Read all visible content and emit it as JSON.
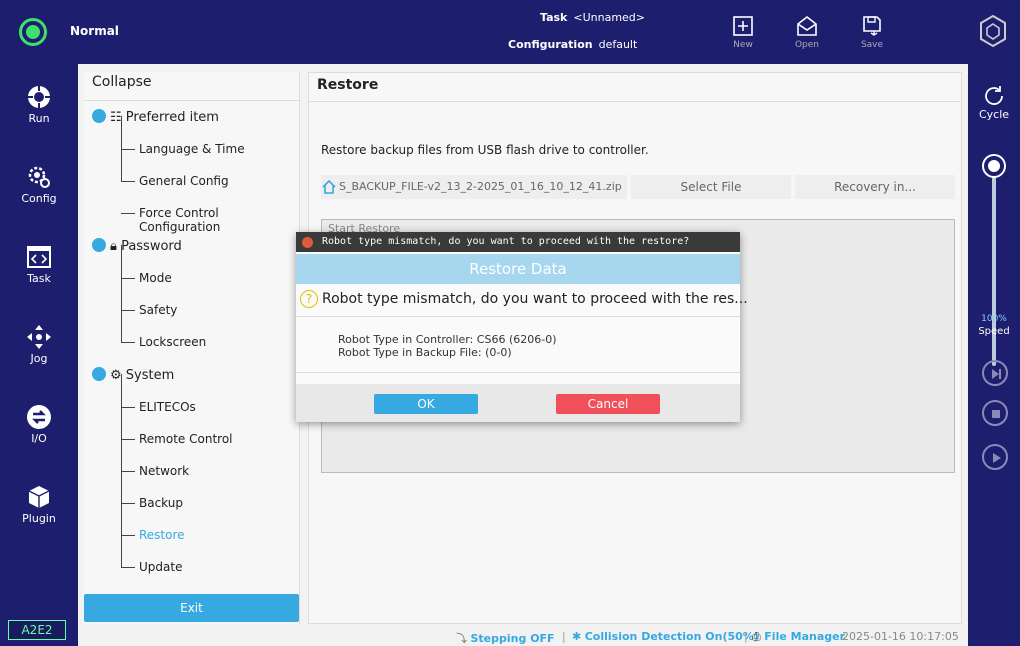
{
  "header": {
    "status": "Normal",
    "task_label": "Task",
    "task_value": "<Unnamed>",
    "config_label": "Configuration",
    "config_value": "default",
    "new_label": "New",
    "open_label": "Open",
    "save_label": "Save"
  },
  "leftnav": {
    "run": "Run",
    "config": "Config",
    "task": "Task",
    "jog": "Jog",
    "io": "I/O",
    "plugin": "Plugin",
    "badge": "A2E2"
  },
  "rightnav": {
    "cycle": "Cycle",
    "speed_value": "100%",
    "speed_label": "Speed",
    "speed_fraction": 1.0
  },
  "tree": {
    "collapse": "Collapse",
    "groups": {
      "preferred": "Preferred item",
      "password": "Password",
      "system": "System"
    },
    "items": {
      "language": "Language & Time",
      "general": "General Config",
      "force": "Force Control Configuration",
      "mode": "Mode",
      "safety": "Safety",
      "lockscreen": "Lockscreen",
      "elitecos": "ELITECOs",
      "remote": "Remote Control",
      "network": "Network",
      "backup": "Backup",
      "restore": "Restore",
      "update": "Update"
    },
    "exit": "Exit"
  },
  "content": {
    "title": "Restore",
    "description": "Restore backup files from USB flash drive to controller.",
    "file_name": "S_BACKUP_FILE-v2_13_2-2025_01_16_10_12_41.zip",
    "select_file": "Select File",
    "recovery": "Recovery in...",
    "log_label": "Start Restore"
  },
  "statusbar": {
    "stepping": "Stepping OFF",
    "collision": "Collision Detection On(50%)",
    "file_manager": "File Manager",
    "datetime": "2025-01-16 10:17:05"
  },
  "dialog": {
    "window_title": "Robot type mismatch, do you want to proceed with the restore?",
    "header": "Restore Data",
    "question": "Robot type mismatch, do you want to proceed with the res...",
    "controller_type": "Robot Type in Controller: CS66 (6206-0)",
    "backup_type": "Robot Type in Backup File: (0-0)",
    "ok": "OK",
    "cancel": "Cancel"
  },
  "colors": {
    "accent": "#36a9e1",
    "navy": "#1e1e6e",
    "status_green": "#3ee06a",
    "cancel_red": "#f0505a"
  }
}
